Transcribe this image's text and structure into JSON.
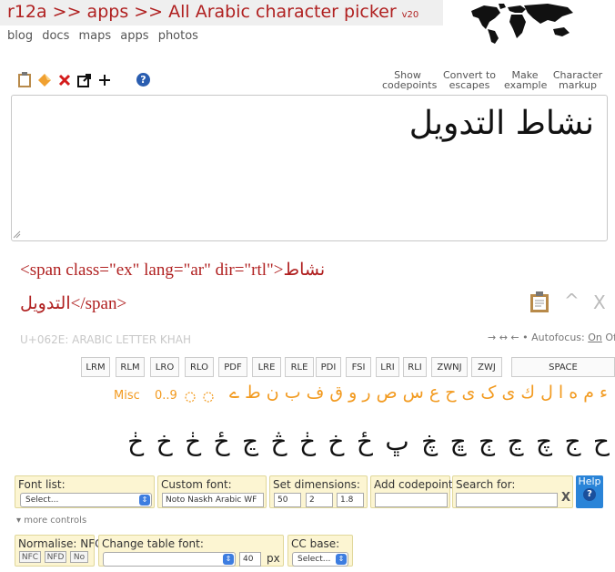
{
  "header": {
    "breadcrumb": "r12a >> apps >> All Arabic character picker",
    "version": "v20",
    "nav": [
      "blog",
      "docs",
      "maps",
      "apps",
      "photos"
    ]
  },
  "toolbar": {
    "links": {
      "show_codepoints": [
        "Show",
        "codepoints"
      ],
      "convert_escapes": [
        "Convert to",
        "escapes"
      ],
      "make_example": [
        "Make",
        "example"
      ],
      "character_markup": [
        "Character",
        "markup"
      ]
    },
    "help_glyph": "?"
  },
  "output": {
    "text": "نشاط التدويل"
  },
  "markup": {
    "line1": "<span class=\"ex\" lang=\"ar\" dir=\"rtl\">نشاط",
    "line2": "التدويل</span>"
  },
  "char_info": {
    "name": "U+062E: ARABIC LETTER KHAH",
    "autofocus_arrows": "→ ↔ ←",
    "autofocus_label": "• Autofocus:",
    "autofocus_on": "On",
    "autofocus_off": "Off"
  },
  "controls": [
    "LRM",
    "RLM",
    "LRO",
    "RLO",
    "PDF",
    "LRE",
    "RLE",
    "PDI",
    "FSI",
    "LRI",
    "RLI",
    "ZWNJ",
    "ZWJ",
    "SPACE"
  ],
  "misc_row": {
    "misc_label": "Misc",
    "digits_label": "0..9",
    "letters": "ء م ه ا ل ك ی ک ى ح ع س ص ر و ق ف ب ن ط ے"
  },
  "khah_row": [
    "ح",
    "ج",
    "چ",
    "ڃ",
    "ڄ",
    "ڇ",
    "ڿ",
    "ڀ",
    "ځ",
    "خ",
    "ڂ",
    "څ",
    "ڃ",
    "ځ",
    "ڂ",
    "خ",
    "ڂ"
  ],
  "panels": {
    "font_list": {
      "label": "Font list:",
      "value": "Select..."
    },
    "custom_font": {
      "label": "Custom font:",
      "value": "Noto Naskh Arabic WF"
    },
    "set_dimensions": {
      "label": "Set dimensions:",
      "values": [
        "50",
        "2",
        "1.8"
      ]
    },
    "add_codepoint": {
      "label": "Add codepoint:",
      "value": ""
    },
    "search_for": {
      "label": "Search for:",
      "value": "",
      "clear": "X"
    },
    "help": {
      "label": "Help",
      "glyph": "?"
    },
    "more_controls": "▾  more controls",
    "normalise": {
      "label": "Normalise: NFC",
      "buttons": [
        "NFC",
        "NFD",
        "No"
      ]
    },
    "change_table_font": {
      "label": "Change table font:",
      "value": "",
      "size": "40",
      "unit": "px"
    },
    "cc_base": {
      "label": "CC base:",
      "value": "Select..."
    }
  },
  "colors": {
    "accent_red": "#b02020",
    "orange": "#f29a1f",
    "panel": "#fcf5d2",
    "help_blue": "#2a84d8"
  }
}
